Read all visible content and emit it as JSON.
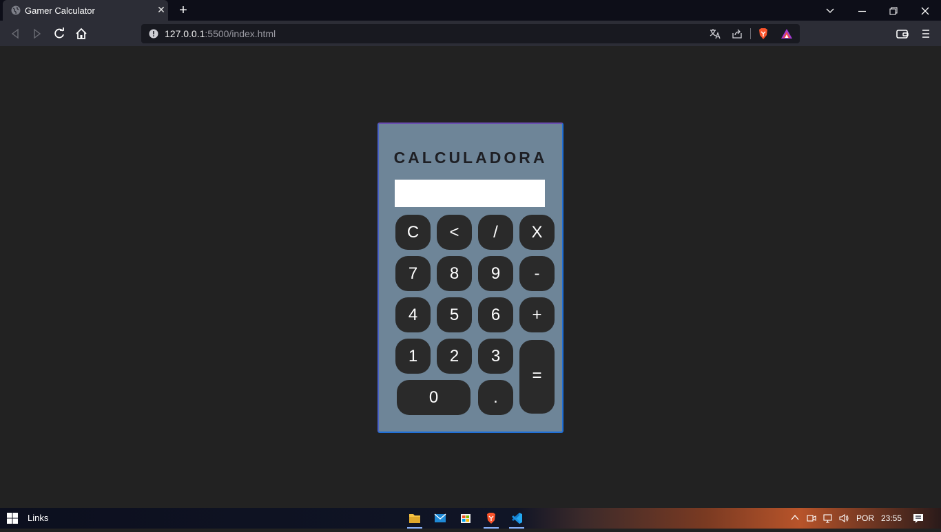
{
  "browser": {
    "tab": {
      "title": "Gamer Calculator",
      "close": "✕"
    },
    "new_tab": "+",
    "window_controls": {
      "dropdown": "⌵",
      "minimize": "—",
      "restore": "❐",
      "close": "✕"
    },
    "address": {
      "host": "127.0.0.1",
      "rest": ":5500/index.html"
    }
  },
  "page": {
    "title": "CALCULADORA",
    "display_value": "",
    "keys": {
      "clear": "C",
      "backspace": "<",
      "divide": "/",
      "multiply": "X",
      "seven": "7",
      "eight": "8",
      "nine": "9",
      "minus": "-",
      "four": "4",
      "five": "5",
      "six": "6",
      "plus": "+",
      "one": "1",
      "two": "2",
      "three": "3",
      "equals": "=",
      "zero": "0",
      "dot": "."
    },
    "colors": {
      "background": "#222222",
      "calculator": "#6e8598",
      "key": "#2a2a2a",
      "border": "#1f6fd6"
    }
  },
  "taskbar": {
    "links": "Links",
    "language": "POR",
    "time": "23:55"
  }
}
